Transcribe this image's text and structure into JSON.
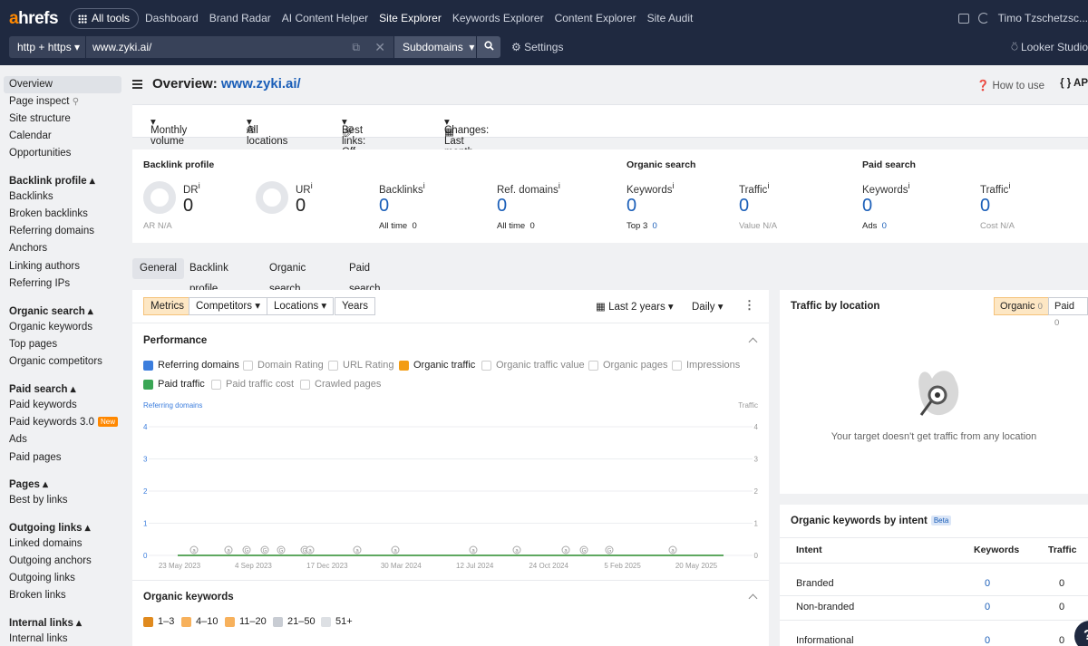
{
  "topbar": {
    "logo": "ahrefs",
    "all_tools": "All tools",
    "nav": [
      "Dashboard",
      "Brand Radar",
      "AI Content Helper",
      "Site Explorer",
      "Keywords Explorer",
      "Content Explorer",
      "Site Audit"
    ],
    "active_nav": "Site Explorer",
    "user": "Timo Tzschetzsc...",
    "protocol": "http + https",
    "url": "www.zyki.ai/",
    "mode": "Subdomains",
    "settings": "Settings",
    "looker": "Looker Studio"
  },
  "sidebar": {
    "top": [
      "Overview",
      "Page inspect",
      "Site structure",
      "Calendar",
      "Opportunities"
    ],
    "sections": [
      {
        "title": "Backlink profile",
        "items": [
          "Backlinks",
          "Broken backlinks",
          "Referring domains",
          "Anchors",
          "Linking authors",
          "Referring IPs"
        ]
      },
      {
        "title": "Organic search",
        "items": [
          "Organic keywords",
          "Top pages",
          "Organic competitors"
        ]
      },
      {
        "title": "Paid search",
        "items": [
          "Paid keywords",
          "Paid keywords 3.0",
          "Ads",
          "Paid pages"
        ]
      },
      {
        "title": "Pages",
        "items": [
          "Best by links"
        ]
      },
      {
        "title": "Outgoing links",
        "items": [
          "Linked domains",
          "Outgoing anchors",
          "Outgoing links",
          "Broken links"
        ]
      },
      {
        "title": "Internal links",
        "items": [
          "Internal links"
        ]
      }
    ],
    "new_badge": "New"
  },
  "header": {
    "title_prefix": "Overview:",
    "title_url": "www.zyki.ai/",
    "how_to_use": "How to use",
    "api": "AP"
  },
  "filters": {
    "volume": "Monthly volume",
    "locations": "All locations",
    "best_links": "Best links: Off",
    "changes": "Changes: Last month"
  },
  "overview": {
    "backlink_profile": "Backlink profile",
    "organic_search": "Organic search",
    "paid_search": "Paid search",
    "dr": {
      "label": "DR",
      "value": "0",
      "sub": "AR  N/A"
    },
    "ur": {
      "label": "UR",
      "value": "0"
    },
    "backlinks": {
      "label": "Backlinks",
      "value": "0",
      "sub_label": "All time",
      "sub_value": "0"
    },
    "ref_domains": {
      "label": "Ref. domains",
      "value": "0",
      "sub_label": "All time",
      "sub_value": "0"
    },
    "org_keywords": {
      "label": "Keywords",
      "value": "0",
      "sub_label": "Top 3",
      "sub_value": "0"
    },
    "org_traffic": {
      "label": "Traffic",
      "value": "0",
      "sub": "Value  N/A"
    },
    "paid_keywords": {
      "label": "Keywords",
      "value": "0",
      "sub_label": "Ads",
      "sub_value": "0"
    },
    "paid_traffic": {
      "label": "Traffic",
      "value": "0",
      "sub": "Cost  N/A"
    }
  },
  "tabs": [
    "General",
    "Backlink profile",
    "Organic search",
    "Paid search"
  ],
  "metrics_panel": {
    "segments": [
      "Metrics",
      "Competitors",
      "Locations",
      "Years"
    ],
    "period": "Last 2 years",
    "granularity": "Daily",
    "performance": "Performance",
    "checkboxes": [
      {
        "label": "Referring domains",
        "checked": true,
        "color": "#3b7ddd"
      },
      {
        "label": "Domain Rating",
        "checked": false
      },
      {
        "label": "URL Rating",
        "checked": false
      },
      {
        "label": "Organic traffic",
        "checked": true,
        "color": "#f39c12"
      },
      {
        "label": "Organic traffic value",
        "checked": false
      },
      {
        "label": "Organic pages",
        "checked": false
      },
      {
        "label": "Impressions",
        "checked": false
      },
      {
        "label": "Paid traffic",
        "checked": true,
        "color": "#3aa655"
      },
      {
        "label": "Paid traffic cost",
        "checked": false
      },
      {
        "label": "Crawled pages",
        "checked": false
      }
    ],
    "organic_keywords": "Organic keywords",
    "position_filters": [
      "1–3",
      "4–10",
      "11–20",
      "21–50",
      "51+"
    ]
  },
  "chart_data": {
    "type": "line",
    "left_axis_label": "Referring domains",
    "right_axis_label": "Traffic",
    "ylim": [
      0,
      4
    ],
    "yticks": [
      "0",
      "1",
      "2",
      "3",
      "4"
    ],
    "x_labels": [
      "23 May 2023",
      "4 Sep 2023",
      "17 Dec 2023",
      "30 Mar 2024",
      "12 Jul 2024",
      "24 Oct 2024",
      "5 Feb 2025",
      "20 May 2025"
    ],
    "series": [
      {
        "name": "Referring domains",
        "color": "#3b7ddd",
        "values": [
          0,
          0,
          0,
          0,
          0,
          0,
          0,
          0
        ]
      },
      {
        "name": "Organic traffic",
        "color": "#f39c12",
        "values": [
          0,
          0,
          0,
          0,
          0,
          0,
          0,
          0
        ]
      },
      {
        "name": "Paid traffic",
        "color": "#3aa655",
        "values": [
          0,
          0,
          0,
          0,
          0,
          0,
          0,
          0
        ]
      }
    ],
    "annotations": [
      "a",
      "a",
      "G",
      "G",
      "G",
      "G",
      "a",
      "a",
      "a",
      "a",
      "a",
      "a",
      "G",
      "G",
      "a"
    ],
    "grid": true
  },
  "traffic_location": {
    "title": "Traffic by location",
    "organic": "Organic",
    "organic_count": "0",
    "paid": "Paid",
    "paid_count": "0",
    "empty": "Your target doesn't get traffic from any location"
  },
  "intent": {
    "title": "Organic keywords by intent",
    "beta": "Beta",
    "headers": [
      "Intent",
      "Keywords",
      "Traffic"
    ],
    "rows": [
      {
        "intent": "Branded",
        "keywords": "0",
        "traffic": "0"
      },
      {
        "intent": "Non-branded",
        "keywords": "0",
        "traffic": "0"
      },
      {
        "intent": "Informational",
        "keywords": "0",
        "traffic": "0"
      }
    ]
  }
}
